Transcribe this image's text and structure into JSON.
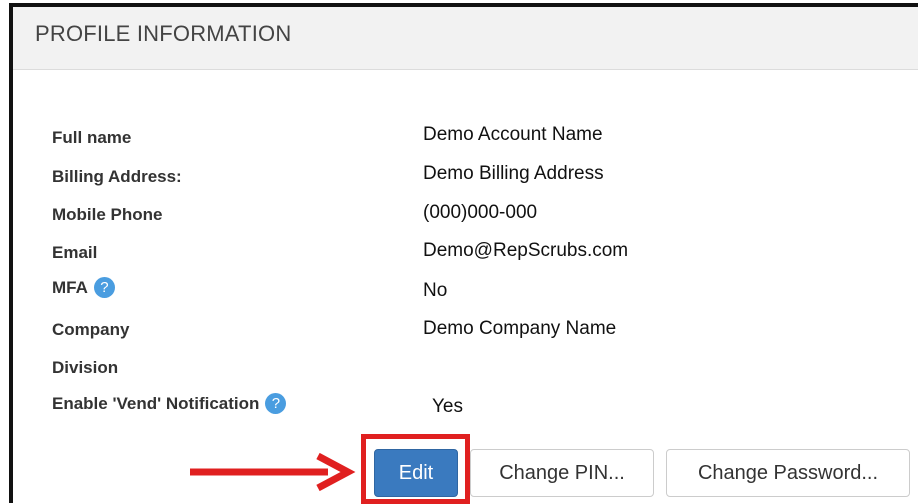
{
  "panel": {
    "title": "PROFILE INFORMATION"
  },
  "fields": [
    {
      "label": "Full name",
      "value": "Demo Account Name"
    },
    {
      "label": "Billing Address:",
      "value": "Demo Billing Address"
    },
    {
      "label": "Mobile Phone",
      "value": "(000)000-000"
    },
    {
      "label": "Email",
      "value": "Demo@RepScrubs.com"
    },
    {
      "label": "MFA",
      "value": "No"
    },
    {
      "label": "Company",
      "value": "Demo Company Name"
    },
    {
      "label": "Division",
      "value": ""
    },
    {
      "label": "Enable 'Vend' Notification",
      "value": "Yes"
    }
  ],
  "help_icon_glyph": "?",
  "buttons": {
    "edit": "Edit",
    "change_pin": "Change PIN...",
    "change_password": "Change Password..."
  },
  "colors": {
    "primary": "#3a7abf",
    "highlight": "#e02020",
    "help_icon": "#4a9de0"
  }
}
